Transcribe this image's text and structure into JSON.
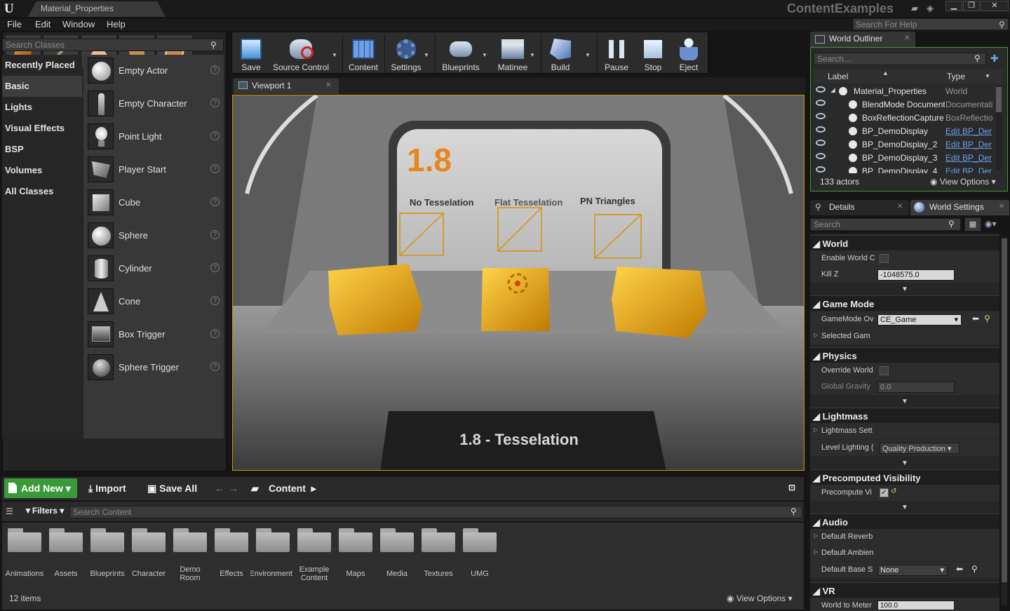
{
  "title_bar": {
    "doc_tab": "Material_Properties",
    "app_title": "ContentExamples",
    "minimize": "▁",
    "maximize": "❐",
    "close": "✕",
    "icons": [
      "chat-icon",
      "feedback-icon"
    ]
  },
  "menu": {
    "items": [
      "File",
      "Edit",
      "Window",
      "Help"
    ],
    "help_search_placeholder": "Search For Help"
  },
  "modes": {
    "buttons": [
      "place-mode-icon",
      "paint-mode-icon",
      "landscape-mode-icon",
      "foliage-mode-icon",
      "geometry-mode-icon"
    ],
    "search_placeholder": "Search Classes",
    "categories": [
      "Recently Placed",
      "Basic",
      "Lights",
      "Visual Effects",
      "BSP",
      "Volumes",
      "All Classes"
    ],
    "selected_category": "Basic",
    "items": [
      "Empty Actor",
      "Empty Character",
      "Point Light",
      "Player Start",
      "Cube",
      "Sphere",
      "Cylinder",
      "Cone",
      "Box Trigger",
      "Sphere Trigger"
    ]
  },
  "toolbar": {
    "save": "Save",
    "source_control": "Source Control",
    "content": "Content",
    "settings": "Settings",
    "blueprints": "Blueprints",
    "matinee": "Matinee",
    "build": "Build",
    "pause": "Pause",
    "stop": "Stop",
    "eject": "Eject"
  },
  "viewport": {
    "tab_label": "Viewport 1",
    "scene_number": "1.8",
    "labels": [
      "No Tesselation",
      "Flat Tesselation",
      "PN Triangles"
    ],
    "sign_text": "1.8 - Tesselation",
    "colors": {
      "accent": "#c69a00",
      "number": "#e8861c",
      "cube": "#f0b800"
    }
  },
  "content_browser": {
    "add_new": "Add New",
    "import": "Import",
    "save_all": "Save All",
    "path": "Content",
    "filters": "Filters",
    "search_placeholder": "Search Content",
    "folders": [
      "Animations",
      "Assets",
      "Blueprints",
      "Character",
      "Demo Room",
      "Effects",
      "Environment",
      "Example Content",
      "Maps",
      "Media",
      "Textures",
      "UMG"
    ],
    "item_count": "12 items",
    "view_options": "View Options"
  },
  "world_outliner": {
    "tab_label": "World Outliner",
    "search_placeholder": "Search...",
    "col_label": "Label",
    "col_type": "Type",
    "rows": [
      {
        "name": "Material_Properties",
        "type": "World",
        "link": false
      },
      {
        "name": "BlendMode Document",
        "type": "Documentati",
        "link": false
      },
      {
        "name": "BoxReflectionCapture",
        "type": "BoxReflectio",
        "link": false
      },
      {
        "name": "BP_DemoDisplay",
        "type": "Edit BP_Der",
        "link": true
      },
      {
        "name": "BP_DemoDisplay_2",
        "type": "Edit BP_Der",
        "link": true
      },
      {
        "name": "BP_DemoDisplay_3",
        "type": "Edit BP_Der",
        "link": true
      },
      {
        "name": "BP_DemoDisplay_4",
        "type": "Edit BP_Der",
        "link": true
      }
    ],
    "actor_count": "133 actors",
    "view_options": "View Options"
  },
  "details": {
    "tab_details": "Details",
    "tab_world_settings": "World Settings",
    "search_placeholder": "Search",
    "world": {
      "header": "World",
      "enable_world_label": "Enable World C",
      "kill_z_label": "Kill Z",
      "kill_z_value": "-1048575.0"
    },
    "game_mode": {
      "header": "Game Mode",
      "override_label": "GameMode Ov",
      "override_value": "CE_Game",
      "selected_label": "Selected Gam"
    },
    "physics": {
      "header": "Physics",
      "override_label": "Override World",
      "gravity_label": "Global Gravity",
      "gravity_value": "0.0"
    },
    "lightmass": {
      "header": "Lightmass",
      "settings_label": "Lightmass Sett",
      "quality_label": "Level Lighting (",
      "quality_value": "Quality Production"
    },
    "precomputed": {
      "header": "Precomputed Visibility",
      "label": "Precompute Vi"
    },
    "audio": {
      "header": "Audio",
      "reverb_label": "Default Reverb",
      "ambient_label": "Default Ambien",
      "base_label": "Default Base S",
      "base_value": "None"
    },
    "vr": {
      "header": "VR",
      "meters_label": "World to Meter",
      "meters_value": "100.0"
    }
  }
}
